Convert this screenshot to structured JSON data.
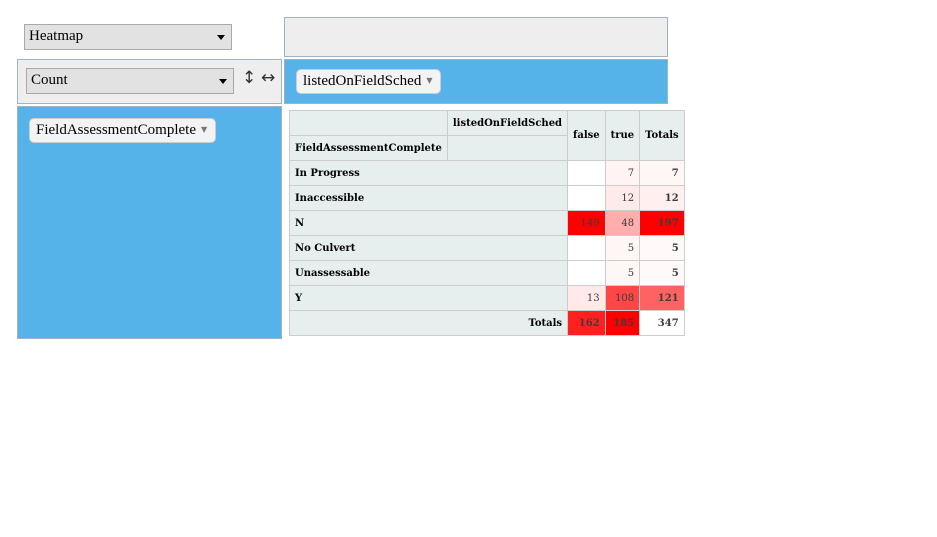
{
  "renderer": {
    "selected": "Heatmap"
  },
  "aggregator": {
    "selected": "Count"
  },
  "icons": {
    "sort_rows": "up-down-arrow-icon",
    "sort_cols": "left-right-arrow-icon"
  },
  "cols_attr": {
    "label": "listedOnFieldSched"
  },
  "rows_attr": {
    "label": "FieldAssessmentComplete"
  },
  "colors": {
    "panel_blue": "#56b3ea",
    "header_bg": "#e6eeee",
    "heat_max": "#ff0000"
  },
  "table": {
    "col_attr_label": "listedOnFieldSched",
    "row_attr_label": "FieldAssessmentComplete",
    "col_headers": [
      "false",
      "true"
    ],
    "totals_label": "Totals",
    "rows": [
      {
        "label": "In Progress",
        "values": [
          "",
          "7"
        ],
        "total": "7"
      },
      {
        "label": "Inaccessible",
        "values": [
          "",
          "12"
        ],
        "total": "12"
      },
      {
        "label": "N",
        "values": [
          "149",
          "48"
        ],
        "total": "197"
      },
      {
        "label": "No Culvert",
        "values": [
          "",
          "5"
        ],
        "total": "5"
      },
      {
        "label": "Unassessable",
        "values": [
          "",
          "5"
        ],
        "total": "5"
      },
      {
        "label": "Y",
        "values": [
          "13",
          "108"
        ],
        "total": "121"
      }
    ],
    "col_totals": [
      "162",
      "185"
    ],
    "grand_total": "347"
  }
}
